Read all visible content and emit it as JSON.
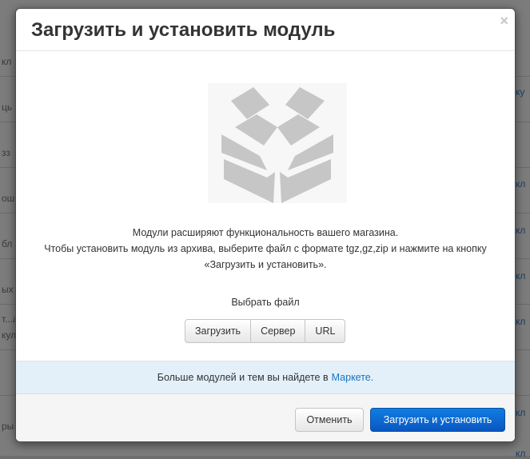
{
  "background": {
    "left_fragments": [
      "кл",
      "ць",
      "зз",
      "ош",
      "бл",
      "ых",
      "т...а",
      "кул",
      "ры"
    ],
    "right_fragments": [
      "ку",
      "кл",
      "кл",
      "кл",
      "кл",
      "кл",
      "кл"
    ]
  },
  "modal": {
    "title": "Загрузить и установить модуль",
    "close_label": "×",
    "description": {
      "line1": "Модули расширяют функциональность вашего магазина.",
      "line2": "Чтобы установить модуль из архива, выберите файл с формате tgz,gz,zip и нажмите на кнопку",
      "line3": "«Загрузить и установить»."
    },
    "choose_file_label": "Выбрать файл",
    "source_buttons": [
      "Загрузить",
      "Сервер",
      "URL"
    ],
    "market_text": "Больше модулей и тем вы найдете в",
    "market_link": "Маркете.",
    "cancel_label": "Отменить",
    "submit_label": "Загрузить и установить"
  },
  "colors": {
    "primary_button": "#0a6ad8",
    "link": "#1a74c4",
    "info_bar": "#e3f0fa",
    "icon_gray": "#c6c6c6"
  },
  "icons": [
    "open-box-icon",
    "close-icon"
  ]
}
